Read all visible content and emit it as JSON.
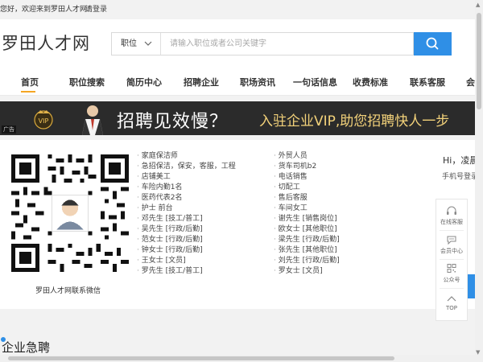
{
  "topbar": {
    "welcome": "您好，欢迎来到罗田人才网！",
    "login": "请登录"
  },
  "header": {
    "logo": "罗田人才网",
    "search_type": "职位",
    "search_placeholder": "请输入职位或者公司关键字"
  },
  "nav": {
    "items": [
      "首页",
      "职位搜索",
      "简历中心",
      "招聘企业",
      "职场资讯",
      "一句话信息",
      "收费标准",
      "联系客服",
      "会员"
    ],
    "active_index": 0
  },
  "banner": {
    "ad_label": "广告",
    "vip_text": "VIP",
    "headline": "招聘见效慢？",
    "subline": "入驻企业VIP,助您招聘快人一步"
  },
  "wechat": {
    "caption": "罗田人才网联系微信"
  },
  "info_list": {
    "col1": [
      "家庭保洁师",
      "急招保洁，保安，客服，工程",
      "店铺美工",
      "车险内勤1名",
      "医药代表2名",
      "护士 前台",
      "邓先生 [技工/普工]",
      "吴先生 [行政/后勤]",
      "范女士 [行政/后勤]",
      "钟女士 [行政/后勤]",
      "王女士 [文员]",
      "罗先生 [技工/普工]"
    ],
    "col2": [
      "外贸人员",
      "货车司机b2",
      "电话销售",
      "切配工",
      "售后客服",
      "车间女工",
      "谢先生 [销售岗位]",
      "欧女士 [其他职位]",
      "梁先生 [行政/后勤]",
      "张先生 [其他职位]",
      "刘先生 [行政/后勤]",
      "罗女士 [文员]"
    ]
  },
  "user_panel": {
    "greeting": "Hi，凌晨",
    "phone_login": "手机号登录"
  },
  "floatbar": {
    "items": [
      {
        "icon": "headset-icon",
        "label": "在线客服"
      },
      {
        "icon": "chat-icon",
        "label": "会员中心"
      },
      {
        "icon": "qrcode-icon",
        "label": "公众号"
      },
      {
        "icon": "chevron-up-icon",
        "label": "TOP"
      }
    ]
  },
  "section": {
    "title": "企业急聘"
  },
  "colors": {
    "accent": "#2f8fe6",
    "underline": "#f5a623",
    "banner_bg": "#2b2b2b",
    "gold": "#f0c35a"
  }
}
